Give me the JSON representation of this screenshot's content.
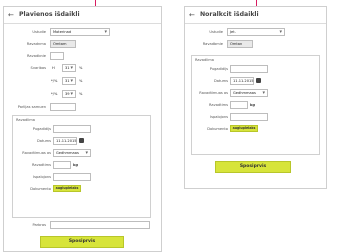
{
  "left": {
    "title": "Plavienos išdaikli",
    "fields": {
      "unit_label": "Ustudie",
      "unit_value": "Moterinad",
      "name_label": "Ravadnma",
      "name_value": "Omtam",
      "name2_label": "Ravadbnie",
      "name2_value": "",
      "size_label": "Svaribas",
      "size_rows": [
        {
          "prefix": "H",
          "value": "31",
          "unit": "%"
        },
        {
          "prefix": "*/%",
          "value": "31",
          "unit": "%"
        },
        {
          "prefix": "*/%",
          "value": "39",
          "unit": "%"
        }
      ],
      "extra_label": "Parlijas samuen",
      "extra_value": ""
    },
    "section": {
      "title": "Ravadlima",
      "f1_label": "Pugadidijs",
      "f1_value": "",
      "date_label": "Datums",
      "date_value": "11.11.2015",
      "f3_label": "Ravadtimuas as",
      "f3_value": "Gedhmmaas",
      "f4_label": "Ravadtims",
      "f4_value": "",
      "f4_unit": "kg",
      "f5_label": "Ispalojons",
      "f5_value": "",
      "doc_label": "Dokumento",
      "upload_label": "augiuplelaks"
    },
    "bottom_label": "Parbras",
    "bottom_value": "",
    "submit_label": "Sposiprvis"
  },
  "right": {
    "title": "Noralkcit išdaikli",
    "fields": {
      "unit_label": "Ustudie",
      "unit_value": "Jet.",
      "name_label": "Ravadbmie",
      "name_value": "Omtan"
    },
    "section": {
      "title": "Ravadlima",
      "f1_label": "Pugadidijs",
      "f1_value": "",
      "date_label": "Datums",
      "date_value": "11.11.2015",
      "f3_label": "Ravadtimuas as",
      "f3_value": "Gedhmmaas",
      "f4_label": "Ravadtims",
      "f4_value": "",
      "f4_unit": "kg",
      "f5_label": "Ispalojons",
      "f5_value": "",
      "doc_label": "Dokumento",
      "upload_label": "augiuplelaks"
    },
    "submit_label": "Sposiprvis"
  },
  "colors": {
    "accent": "#d81b60",
    "button": "#d7e43a",
    "border": "#cfcfcf"
  },
  "icons": {
    "back": "arrow-left-icon",
    "calendar": "calendar-icon",
    "dropdown": "chevron-down-icon"
  }
}
